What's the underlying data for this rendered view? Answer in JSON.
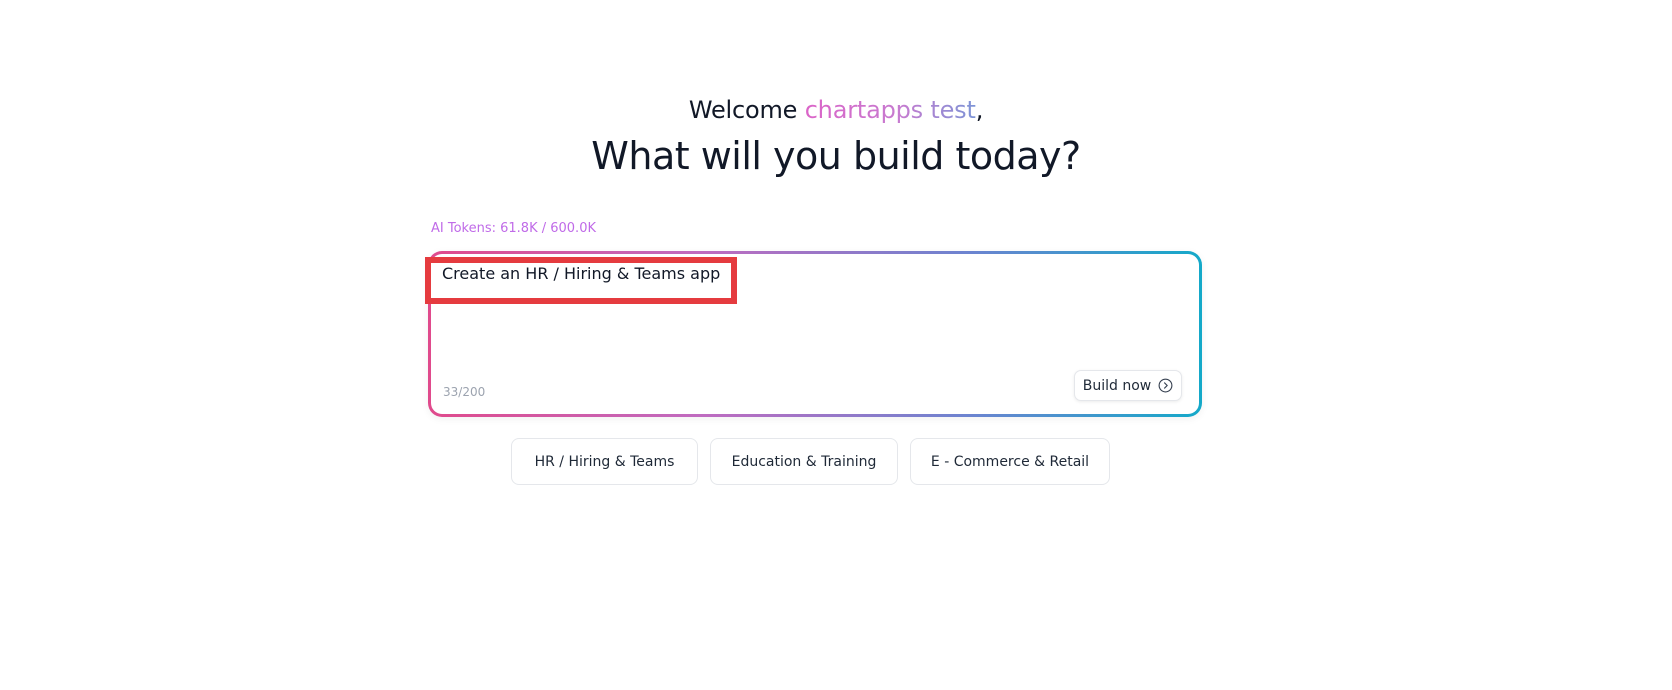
{
  "header": {
    "welcome_prefix": "Welcome",
    "user_name": "chartapps test",
    "welcome_suffix": ",",
    "headline": "What will you build today?"
  },
  "prompt": {
    "tokens_label": "AI Tokens: 61.8K / 600.0K",
    "value": "Create an HR / Hiring & Teams app",
    "char_count": "33/200",
    "build_label": "Build now",
    "build_icon": "chevron-right-circle-icon",
    "gradient_colors": [
      "#e04a8c",
      "#c06bc0",
      "#6c84d0",
      "#14a9c9"
    ]
  },
  "suggestions": [
    {
      "label": "HR / Hiring & Teams"
    },
    {
      "label": "Education & Training"
    },
    {
      "label": "E - Commerce & Retail"
    }
  ],
  "colors": {
    "highlight": "#e53b3f",
    "tokens": "#c06be8",
    "name_gradient": [
      "#db64c8",
      "#7c94d6"
    ]
  }
}
